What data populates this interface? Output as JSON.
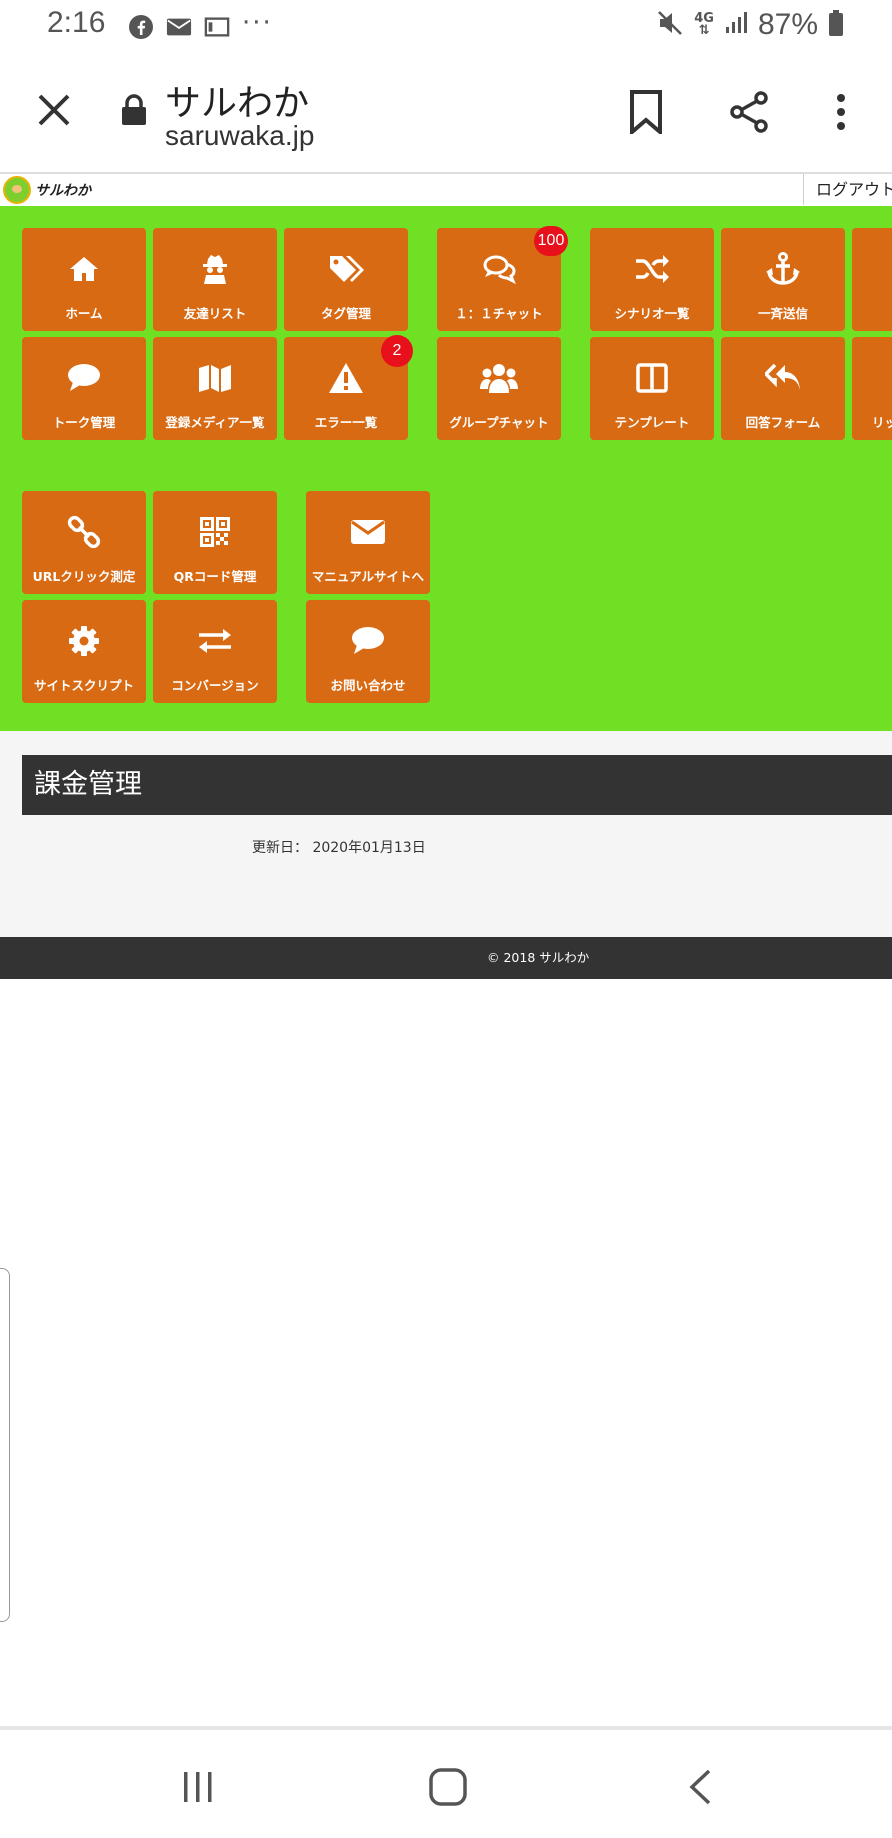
{
  "status_bar": {
    "time": "2:16",
    "network": "4G",
    "battery": "87%",
    "dots": "···"
  },
  "browser": {
    "site_title": "サルわか",
    "url": "saruwaka.jp"
  },
  "site_header": {
    "logo_text": "サルわか",
    "logout_label": "ログアウト"
  },
  "menu": {
    "tiles": [
      {
        "label": "ホーム",
        "icon": "home-icon"
      },
      {
        "label": "友達リスト",
        "icon": "spy-icon"
      },
      {
        "label": "タグ管理",
        "icon": "tags-icon"
      },
      {
        "label": "１：１チャット",
        "icon": "chat-bubbles-icon",
        "badge": "100"
      },
      {
        "label": "シナリオ一覧",
        "icon": "shuffle-icon"
      },
      {
        "label": "一斉送信",
        "icon": "anchor-icon"
      },
      {
        "label": "トーク管理",
        "icon": "comment-icon"
      },
      {
        "label": "登録メディア一覧",
        "icon": "map-icon"
      },
      {
        "label": "エラー一覧",
        "icon": "warning-icon",
        "badge": "2"
      },
      {
        "label": "グループチャット",
        "icon": "users-icon"
      },
      {
        "label": "テンプレート",
        "icon": "columns-icon"
      },
      {
        "label": "回答フォーム",
        "icon": "reply-all-icon"
      },
      {
        "label": "リッ",
        "icon": ""
      },
      {
        "label": "URLクリック測定",
        "icon": "link-icon"
      },
      {
        "label": "QRコード管理",
        "icon": "qrcode-icon"
      },
      {
        "label": "マニュアルサイトへ",
        "icon": "envelope-icon"
      },
      {
        "label": "サイトスクリプト",
        "icon": "gear-icon"
      },
      {
        "label": "コンバージョン",
        "icon": "exchange-icon"
      },
      {
        "label": "お問い合わせ",
        "icon": "comment-icon"
      }
    ]
  },
  "content": {
    "section_title": "課金管理",
    "updated": "更新日： 2020年01月13日"
  },
  "footer": {
    "copyright": "© 2018 サルわか"
  },
  "colors": {
    "menu_background": "#6fe024",
    "tile": "#d86a14",
    "badge": "#e8101a",
    "section_bar": "#333333"
  }
}
